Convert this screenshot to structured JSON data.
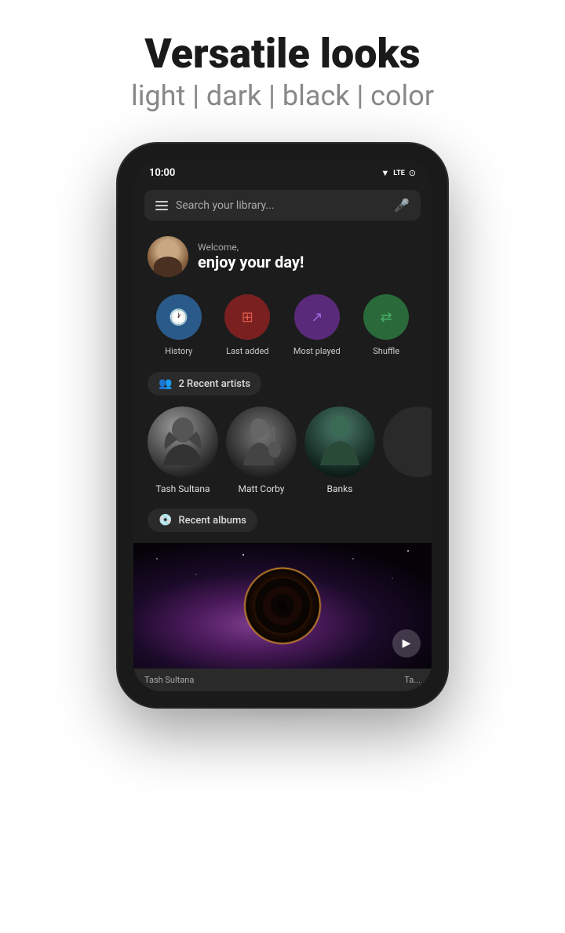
{
  "header": {
    "title": "Versatile looks",
    "subtitle": "light | dark | black | color"
  },
  "status_bar": {
    "time": "10:00",
    "icons": [
      "wifi",
      "lte",
      "battery"
    ]
  },
  "search": {
    "placeholder": "Search your library..."
  },
  "welcome": {
    "label": "Welcome,",
    "greeting": "enjoy your day!"
  },
  "quick_actions": [
    {
      "id": "history",
      "label": "History",
      "icon": "🕐",
      "color": "blue"
    },
    {
      "id": "last_added",
      "label": "Last added",
      "icon": "➕",
      "color": "red"
    },
    {
      "id": "most_played",
      "label": "Most played",
      "icon": "📈",
      "color": "purple"
    },
    {
      "id": "shuffle",
      "label": "Shuffle",
      "icon": "⇄",
      "color": "green"
    }
  ],
  "recent_artists": {
    "chip_label": "Recent artists",
    "count": 2,
    "artists": [
      {
        "name": "Tash Sultana",
        "style": "tash"
      },
      {
        "name": "Matt Corby",
        "style": "matt"
      },
      {
        "name": "Banks",
        "style": "banks"
      },
      {
        "name": "",
        "style": "unknown"
      }
    ]
  },
  "recent_albums": {
    "chip_label": "Recent albums",
    "album_artist": "Tash Sultana"
  }
}
